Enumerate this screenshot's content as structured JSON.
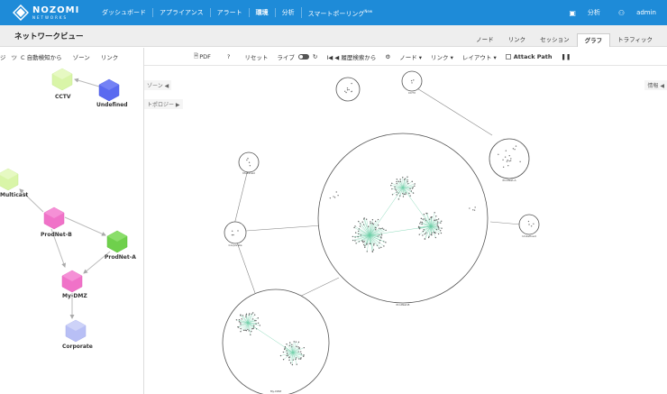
{
  "header": {
    "brand": "NOZOMI",
    "brand_sub": "NETWORKS",
    "nav": [
      {
        "label": "ダッシュボード"
      },
      {
        "label": "アプライアンス"
      },
      {
        "label": "アラート"
      },
      {
        "label": "環境"
      },
      {
        "label": "分析"
      },
      {
        "label": "スマートポーリング",
        "badge": "New"
      }
    ],
    "user_icon_label": "分析",
    "username": "admin"
  },
  "page": {
    "title": "ネットワークビュー",
    "tabs": [
      "ノード",
      "リンク",
      "セッション",
      "グラフ",
      "トラフィック"
    ],
    "active_tab": "グラフ"
  },
  "left_toolbar": {
    "items": [
      "ジ",
      "ツ",
      "C 自動検知から",
      "ゾーン",
      "リンク"
    ]
  },
  "graph_toolbar": {
    "pdf": "PDF",
    "help": "?",
    "reset": "リセット",
    "live": "ライブ",
    "history": "I◀ ◀ 履歴検索から",
    "node": "ノード ▾",
    "link": "リンク ▾",
    "layout": "レイアウト ▾",
    "attack_path": "Attack Path",
    "pause": "❚❚"
  },
  "left_graph": {
    "nodes": [
      {
        "name": "CCTV"
      },
      {
        "name": "Undefined"
      },
      {
        "name": "Multicast"
      },
      {
        "name": "ProdNet-B"
      },
      {
        "name": "ProdNet-A"
      },
      {
        "name": "My-DMZ"
      },
      {
        "name": "Corporate"
      }
    ],
    "colors": {
      "light_green": "#d9f5a8",
      "blue": "#5a6af0",
      "pink": "#f072c8",
      "green": "#6fd04c",
      "lavender": "#b8bff5"
    }
  },
  "main_graph": {
    "side_labels": [
      "ゾーン ◀",
      "トポロジー ▶",
      "情報 ◀"
    ],
    "cluster_labels": [
      "Multicast",
      "Corporate",
      "ProdNet-B",
      "My-DMZ",
      "ProdNet-A",
      "Undefined",
      "CCTV"
    ]
  }
}
